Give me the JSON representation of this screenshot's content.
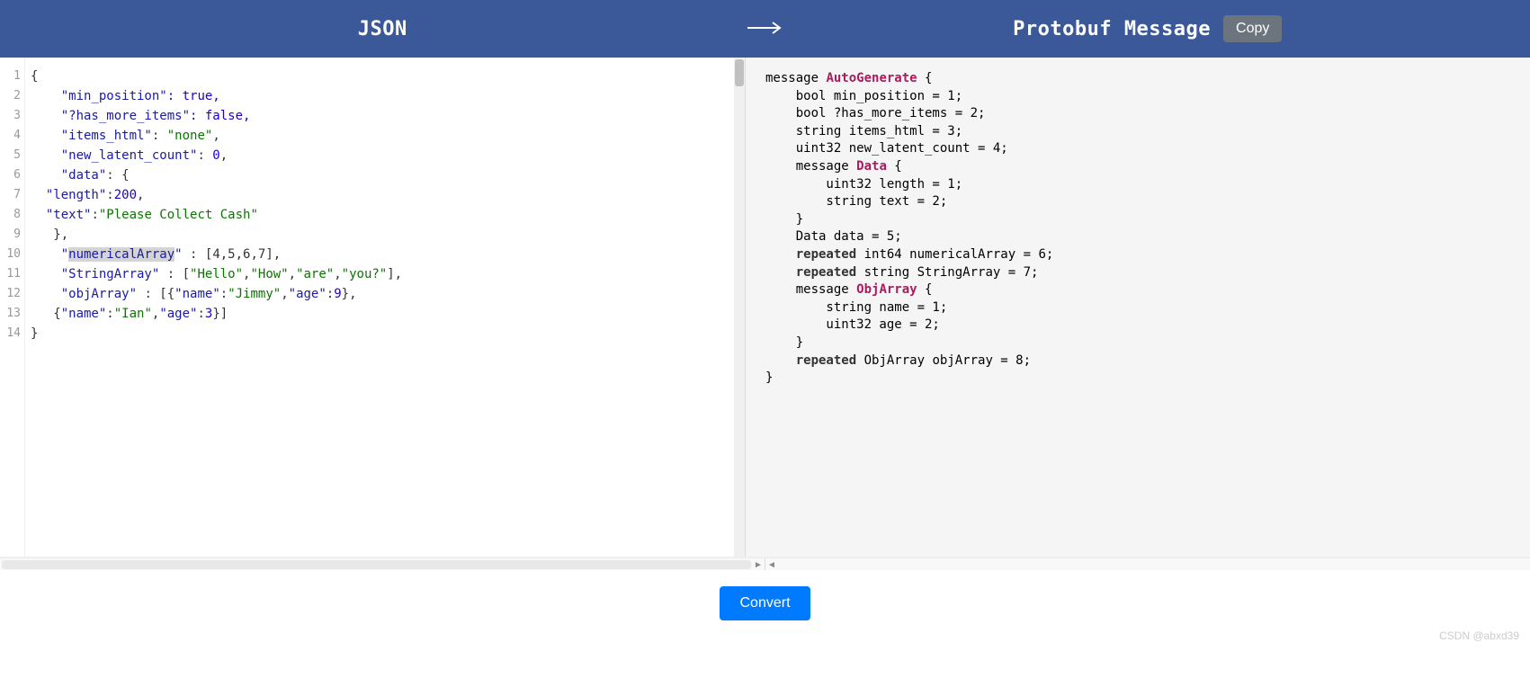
{
  "header": {
    "left_title": "JSON",
    "right_title": "Protobuf Message",
    "copy_label": "Copy"
  },
  "json_editor": {
    "line_count": 14,
    "lines": {
      "l1": "{",
      "l2_key": "\"min_position\"",
      "l2_rest": ": true,",
      "l3_key": "\"?has_more_items\"",
      "l3_rest": ": false,",
      "l4_key": "\"items_html\"",
      "l4_sep": ": ",
      "l4_val": "\"none\"",
      "l4_end": ",",
      "l5_key": "\"new_latent_count\"",
      "l5_sep": ": ",
      "l5_val": "0",
      "l5_end": ",",
      "l6_key": "\"data\"",
      "l6_rest": ": {",
      "l7_key": "\"length\"",
      "l7_sep": ":",
      "l7_val": "200",
      "l7_end": ",",
      "l8_key": "\"text\"",
      "l8_sep": ":",
      "l8_val": "\"Please Collect Cash\"",
      "l9": "   },",
      "l10_key": "\"numericalArray\"",
      "l10_rest": " : [4,5,6,7],",
      "l11_key": "\"StringArray\"",
      "l11_sep": " : [",
      "l11_v1": "\"Hello\"",
      "l11_v2": "\"How\"",
      "l11_v3": "\"are\"",
      "l11_v4": "\"you?\"",
      "l11_end": "],",
      "l12_key": "\"objArray\"",
      "l12_sep": " : [{",
      "l12_k1": "\"name\"",
      "l12_v1": "\"Jimmy\"",
      "l12_k2": "\"age\"",
      "l12_v2": "9",
      "l12_end": "},",
      "l13_pre": "   {",
      "l13_k1": "\"name\"",
      "l13_v1": "\"Ian\"",
      "l13_k2": "\"age\"",
      "l13_v2": "3",
      "l13_end": "}]",
      "l14": "}"
    }
  },
  "proto_output": {
    "lines": {
      "l1_a": "message ",
      "l1_b": "AutoGenerate",
      "l1_c": " {",
      "l2": "    bool min_position = 1;",
      "l3": "    bool ?has_more_items = 2;",
      "l4": "    string items_html = 3;",
      "l5": "    uint32 new_latent_count = 4;",
      "l6_a": "    message ",
      "l6_b": "Data",
      "l6_c": " {",
      "l7": "        uint32 length = 1;",
      "l8": "        string text = 2;",
      "l9": "    }",
      "l10": "    Data data = 5;",
      "l11_a": "    ",
      "l11_b": "repeated",
      "l11_c": " int64 numericalArray = 6;",
      "l12_a": "    ",
      "l12_b": "repeated",
      "l12_c": " string StringArray = 7;",
      "l13_a": "    message ",
      "l13_b": "ObjArray",
      "l13_c": " {",
      "l14": "        string name = 1;",
      "l15": "        uint32 age = 2;",
      "l16": "    }",
      "l17_a": "    ",
      "l17_b": "repeated",
      "l17_c": " ObjArray objArray = 8;",
      "l18": "}"
    }
  },
  "footer": {
    "convert_label": "Convert",
    "watermark": "CSDN @abxd39"
  }
}
